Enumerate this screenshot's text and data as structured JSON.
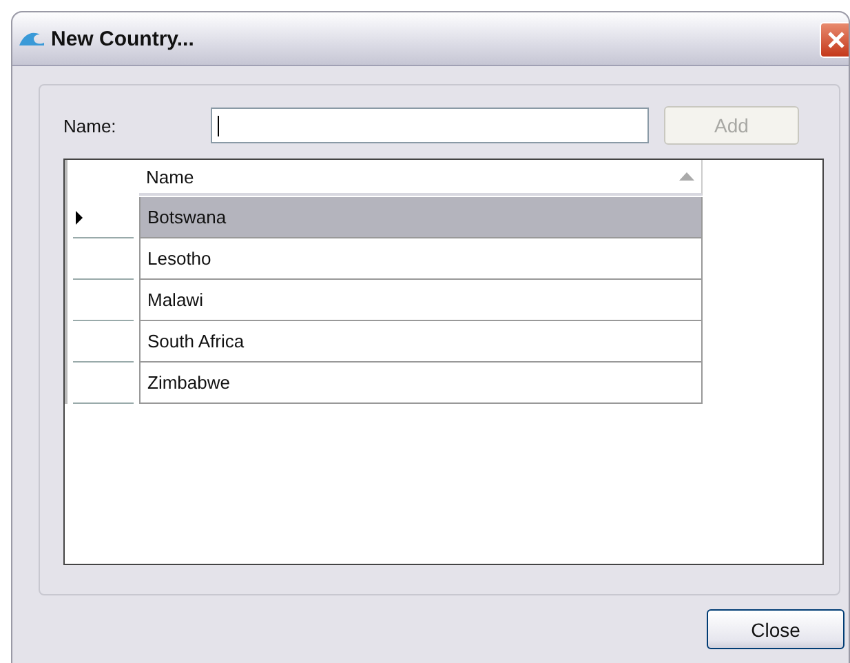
{
  "window": {
    "title": "New Country..."
  },
  "name_field": {
    "label": "Name:",
    "focused": true
  },
  "add_button": {
    "label": "Add",
    "disabled": true
  },
  "grid": {
    "columns": [
      {
        "label": "Name",
        "sort_ascending": true
      }
    ],
    "rows": [
      {
        "name": "Botswana",
        "selected": true
      },
      {
        "name": "Lesotho",
        "selected": false
      },
      {
        "name": "Malawi",
        "selected": false
      },
      {
        "name": "South Africa",
        "selected": false
      },
      {
        "name": "Zimbabwe",
        "selected": false
      }
    ]
  },
  "close_button": {
    "label": "Close"
  }
}
